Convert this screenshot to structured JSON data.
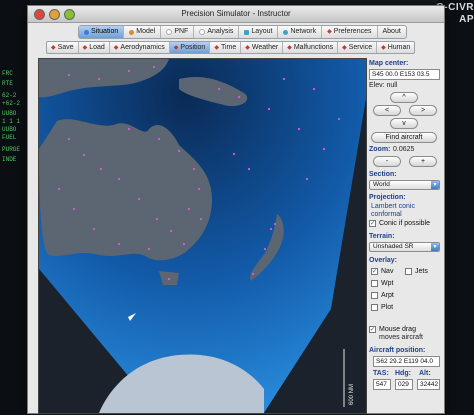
{
  "background": {
    "right_title": "G-CIVR",
    "right_sub": "AP",
    "left_text": [
      "FRC",
      "RTE",
      "62-2",
      "+62-2",
      "UUBO",
      "1 1 1",
      "UUBO",
      "FUEL",
      "PURGE",
      "INDE"
    ]
  },
  "window": {
    "title": "Precision Simulator - Instructor"
  },
  "top_tabs": [
    {
      "label": "Situation",
      "selected": true,
      "dot_color": "#3d7bd6"
    },
    {
      "label": "Model",
      "selected": false,
      "dot_color": "#d88a2f"
    },
    {
      "label": "PNF",
      "selected": false,
      "dot_color": "#cfcfcf"
    },
    {
      "label": "Analysis",
      "selected": false,
      "dot_color": "#cfcfcf"
    },
    {
      "label": "Layout",
      "selected": false,
      "dot_color": "#3aa5c9"
    },
    {
      "label": "Network",
      "selected": false,
      "dot_color": "#3aa5c9"
    },
    {
      "label": "Preferences",
      "selected": false,
      "dot_color": "#c23b2e"
    },
    {
      "label": "About",
      "selected": false,
      "dot_color": "#cfcfcf"
    }
  ],
  "sub_tabs": [
    {
      "label": "Save",
      "selected": false
    },
    {
      "label": "Load",
      "selected": false
    },
    {
      "label": "Aerodynamics",
      "selected": false
    },
    {
      "label": "Position",
      "selected": true
    },
    {
      "label": "Time",
      "selected": false
    },
    {
      "label": "Weather",
      "selected": false
    },
    {
      "label": "Malfunctions",
      "selected": false
    },
    {
      "label": "Service",
      "selected": false
    },
    {
      "label": "Human",
      "selected": false
    }
  ],
  "map": {
    "scale_label": "600 NM"
  },
  "side": {
    "map_center_label": "Map center:",
    "map_center_value": "S45 00.0 E153 03.5",
    "elev_label": "Elev: null",
    "up": "^",
    "left": "<",
    "right": ">",
    "down": "v",
    "find_aircraft": "Find aircraft",
    "zoom_label": "Zoom:",
    "zoom_value": "0.0625",
    "zoom_out": "-",
    "zoom_in": "+",
    "section_label": "Section:",
    "section_value": "World",
    "projection_label": "Projection:",
    "projection_value_1": "Lambert conic",
    "projection_value_2": "conformal",
    "conic_label": "Conic if possible",
    "terrain_label": "Terrain:",
    "terrain_value": "Unshaded SR",
    "overlay_label": "Overlay:",
    "nav": "Nav",
    "jets": "Jets",
    "wpt": "Wpt",
    "arpt": "Arpt",
    "plot": "Plot",
    "mouse_drag_1": "Mouse drag",
    "mouse_drag_2": "moves aircraft",
    "aircraft_pos_label": "Aircraft position:",
    "aircraft_pos_value": "S62 29.2 E119 04.0",
    "tas_label": "TAS:",
    "hdg_label": "Hdg:",
    "alt_label": "Alt:",
    "tas_value": "547",
    "hdg_value": "029",
    "alt_value": "32442"
  }
}
